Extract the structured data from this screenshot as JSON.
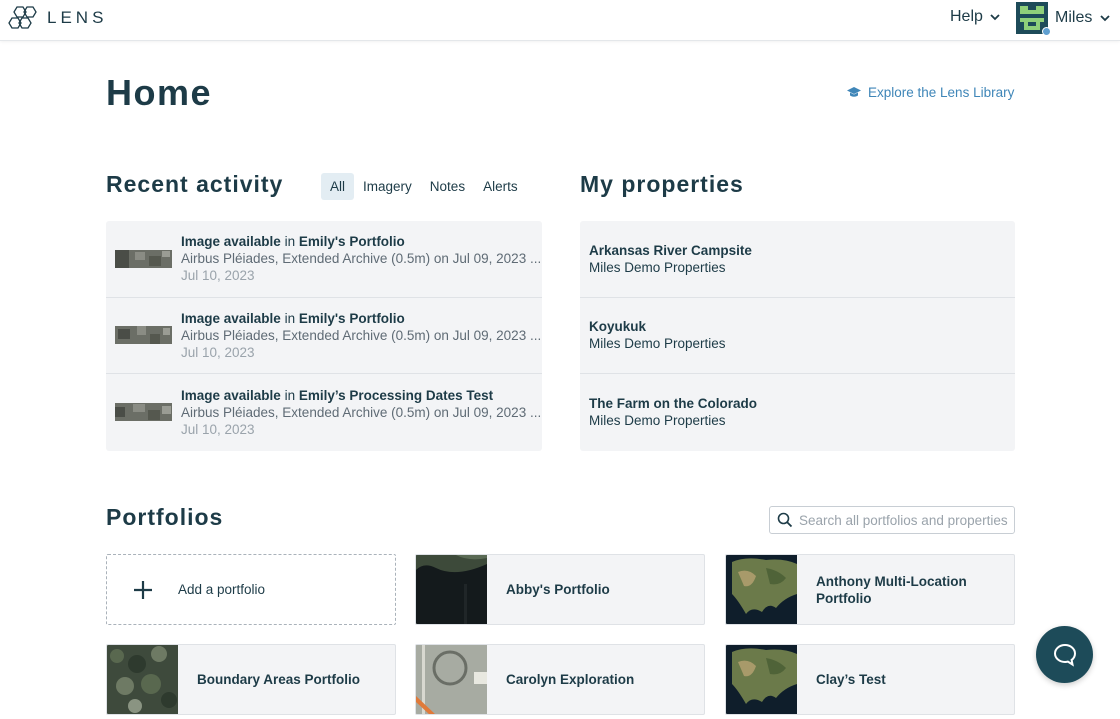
{
  "header": {
    "logo_text": "LENS",
    "help_label": "Help",
    "user_name": "Miles"
  },
  "page": {
    "title": "Home",
    "explore_link": "Explore the Lens Library"
  },
  "recent_activity": {
    "title": "Recent activity",
    "filters": [
      {
        "label": "All",
        "active": true
      },
      {
        "label": "Imagery",
        "active": false
      },
      {
        "label": "Notes",
        "active": false
      },
      {
        "label": "Alerts",
        "active": false
      }
    ],
    "items": [
      {
        "event": "Image available",
        "connector": " in ",
        "target": "Emily's Portfolio",
        "detail": "Airbus Pléiades, Extended Archive (0.5m) on Jul 09, 2023 ...",
        "date": "Jul 10, 2023"
      },
      {
        "event": "Image available",
        "connector": " in ",
        "target": "Emily's Portfolio",
        "detail": "Airbus Pléiades, Extended Archive (0.5m) on Jul 09, 2023 ...",
        "date": "Jul 10, 2023"
      },
      {
        "event": "Image available",
        "connector": " in ",
        "target": "Emily’s Processing Dates Test",
        "detail": "Airbus Pléiades, Extended Archive (0.5m) on Jul 09, 2023 ...",
        "date": "Jul 10, 2023"
      }
    ]
  },
  "my_properties": {
    "title": "My properties",
    "items": [
      {
        "name": "Arkansas River Campsite",
        "group": "Miles Demo Properties"
      },
      {
        "name": "Koyukuk",
        "group": "Miles Demo Properties"
      },
      {
        "name": "The Farm on the Colorado",
        "group": "Miles Demo Properties"
      }
    ]
  },
  "portfolios": {
    "title": "Portfolios",
    "search_placeholder": "Search all portfolios and properties",
    "add_label": "Add a portfolio",
    "cards": [
      {
        "label": "Abby's Portfolio",
        "thumb": "dark-water"
      },
      {
        "label": "Anthony Multi-Location Portfolio",
        "thumb": "us-map"
      },
      {
        "label": "Boundary Areas Portfolio",
        "thumb": "forest"
      },
      {
        "label": "Carolyn Exploration",
        "thumb": "map-roads"
      },
      {
        "label": "Clay’s Test",
        "thumb": "us-map"
      }
    ]
  },
  "colors": {
    "brand_dark": "#1d3b47",
    "link_blue": "#3f86b8",
    "chat_button": "#1d4b59",
    "panel_bg": "#f3f4f6",
    "filter_active_bg": "#e3edf3"
  },
  "icons": {
    "logo": "hexagon-cluster-icon",
    "help_chevron": "chevron-down-icon",
    "explore": "graduation-cap-icon",
    "search": "search-icon",
    "add": "plus-icon",
    "chat": "chat-bubble-icon"
  }
}
